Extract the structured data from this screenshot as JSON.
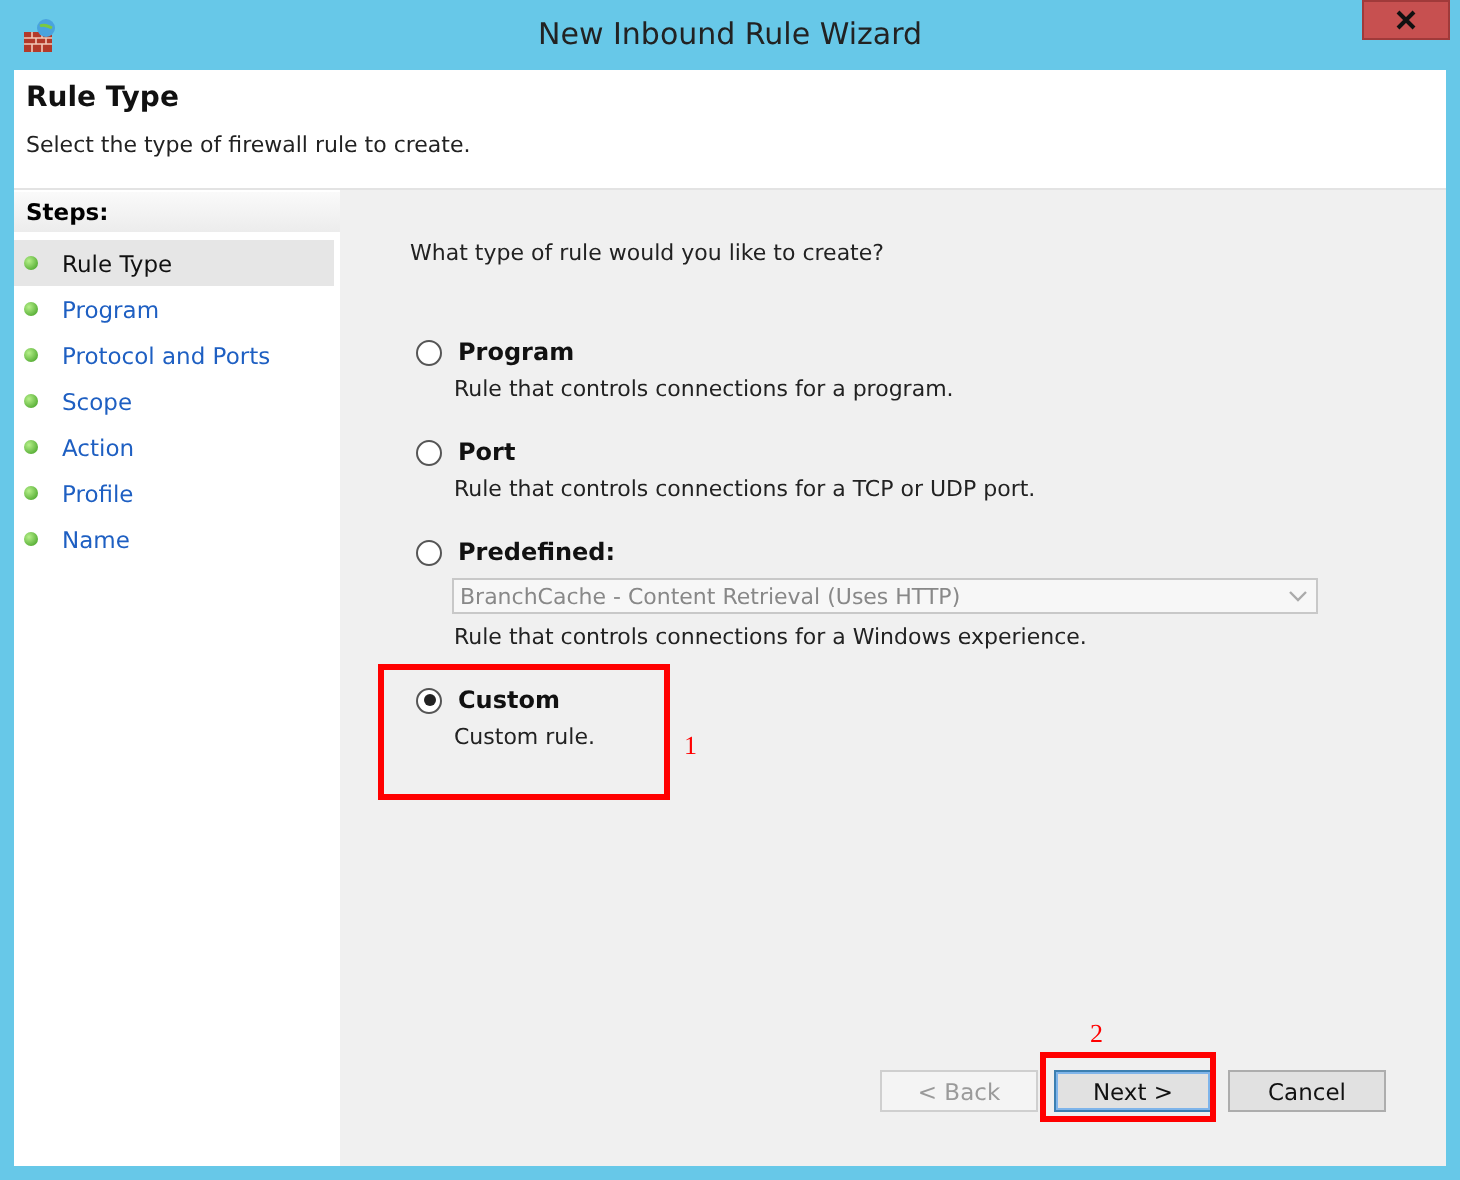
{
  "window": {
    "title": "New Inbound Rule Wizard"
  },
  "header": {
    "title": "Rule Type",
    "subtitle": "Select the type of firewall rule to create."
  },
  "steps": {
    "heading": "Steps:",
    "items": [
      {
        "label": "Rule Type",
        "selected": true
      },
      {
        "label": "Program",
        "selected": false
      },
      {
        "label": "Protocol and Ports",
        "selected": false
      },
      {
        "label": "Scope",
        "selected": false
      },
      {
        "label": "Action",
        "selected": false
      },
      {
        "label": "Profile",
        "selected": false
      },
      {
        "label": "Name",
        "selected": false
      }
    ]
  },
  "question": "What type of rule would you like to create?",
  "options": [
    {
      "label": "Program",
      "description": "Rule that controls connections for a program.",
      "selected": false
    },
    {
      "label": "Port",
      "description": "Rule that controls connections for a TCP or UDP port.",
      "selected": false
    },
    {
      "label": "Predefined:",
      "dropdown": {
        "value": "BranchCache - Content Retrieval (Uses HTTP)",
        "disabled": true
      },
      "description": "Rule that controls connections for a Windows experience.",
      "selected": false
    },
    {
      "label": "Custom",
      "description": "Custom rule.",
      "selected": true,
      "annotation": "1"
    }
  ],
  "buttons": [
    {
      "label": "< Back",
      "disabled": true,
      "default": false
    },
    {
      "label": "Next >",
      "disabled": false,
      "default": true,
      "annotation": "2"
    },
    {
      "label": "Cancel",
      "disabled": false,
      "default": false
    }
  ]
}
